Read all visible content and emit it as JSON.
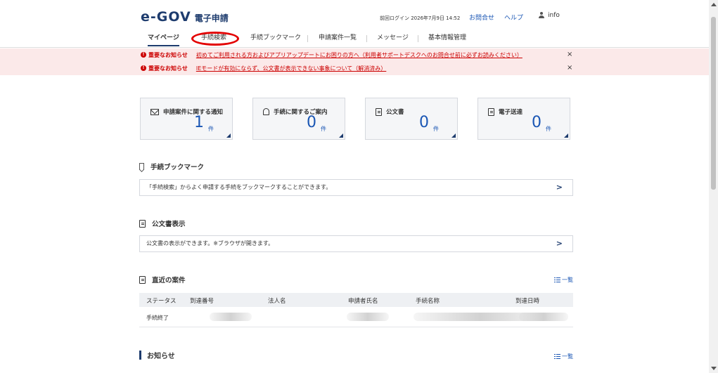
{
  "header": {
    "logo_mark": "e-GOV",
    "logo_text": "電子申請",
    "last_login": "前回ログイン 2026年7月9日 14:52",
    "contact": "お問合せ",
    "help": "ヘルプ",
    "user": "info"
  },
  "nav": {
    "items": [
      "マイページ",
      "手続検索",
      "手続ブックマーク",
      "申請案件一覧",
      "メッセージ",
      "基本情報管理"
    ],
    "active": "マイページ",
    "highlighted": "手続検索"
  },
  "notices": [
    {
      "tag": "重要なお知らせ",
      "message": "初めてご利用される方およびアプリアップデートにお困りの方へ（利用者サポートデスクへのお問合せ前に必ずお読みください）",
      "close": "×"
    },
    {
      "tag": "重要なお知らせ",
      "message": "IEモードが有効にならず、公文書が表示できない事象について（解消済み）",
      "close": "×"
    }
  ],
  "cards": [
    {
      "title": "申請案件に関する通知",
      "count": "1",
      "unit": "件",
      "icon": "mail-icon"
    },
    {
      "title": "手続に関するご案内",
      "count": "0",
      "unit": "件",
      "icon": "bell-icon"
    },
    {
      "title": "公文書",
      "count": "0",
      "unit": "件",
      "icon": "document-icon"
    },
    {
      "title": "電子送達",
      "count": "0",
      "unit": "件",
      "icon": "document-icon"
    }
  ],
  "bookmark": {
    "title": "手続ブックマーク",
    "text": "「手続検索」からよく申請する手続をブックマークすることができます。",
    "chevron": ">"
  },
  "official_docs": {
    "title": "公文書表示",
    "text": "公文書の表示ができます。※ブラウザが開きます。",
    "chevron": ">"
  },
  "recent": {
    "title": "直近の案件",
    "list_link": "一覧",
    "columns": [
      "ステータス",
      "到達番号",
      "法人名",
      "申請者氏名",
      "手続名称",
      "到達日時"
    ],
    "rows": [
      {
        "status": "手続終了"
      }
    ]
  },
  "news": {
    "title": "お知らせ",
    "list_link": "一覧"
  },
  "colors": {
    "brand": "#1e3c6e",
    "link": "#1a56b4",
    "alert": "#cc0000",
    "alert_bg": "#fbe9e9",
    "highlight_circle": "#e30000"
  }
}
